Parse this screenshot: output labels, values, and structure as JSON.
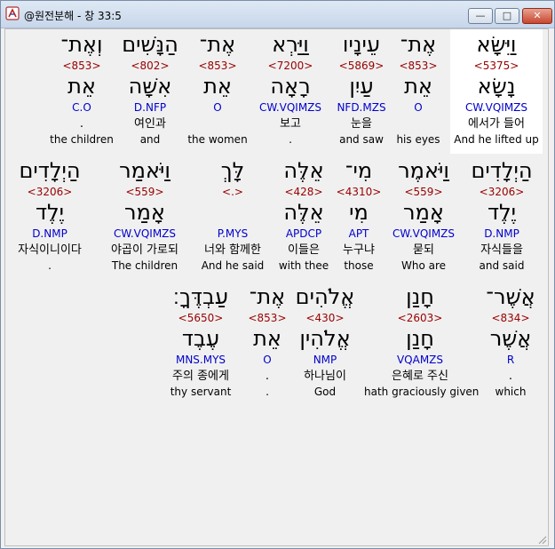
{
  "window": {
    "title": "@원전분해 - 창 33:5",
    "minimize_glyph": "—",
    "maximize_glyph": "□",
    "close_glyph": "✕"
  },
  "rows": [
    [
      {
        "heb1": "וַיִּשָּׂא",
        "num": "<5375>",
        "heb2": "נָשָׂא",
        "parse": "CW.VQIMZS",
        "kor": "에서가 들어",
        "eng": "And he lifted up"
      },
      {
        "heb1": "אֶת־",
        "num": "<853>",
        "heb2": "אֵת",
        "parse": "O",
        "kor": "",
        "eng": "his eyes"
      },
      {
        "heb1": "עֵינָיו",
        "num": "<5869>",
        "heb2": "עַיִן",
        "parse": "NFD.MZS",
        "kor": "눈을",
        "eng": "and saw"
      },
      {
        "heb1": "וַיַּרְא",
        "num": "<7200>",
        "heb2": "רָאָה",
        "parse": "CW.VQIMZS",
        "kor": "보고",
        "eng": "."
      },
      {
        "heb1": "אֶת־",
        "num": "<853>",
        "heb2": "אֵת",
        "parse": "O",
        "kor": "",
        "eng": "the women"
      },
      {
        "heb1": "הַנָּשִׁים",
        "num": "<802>",
        "heb2": "אִשָּׁה",
        "parse": "D.NFP",
        "kor": "여인과",
        "eng": "and"
      },
      {
        "heb1": "וְאֶת־",
        "num": "<853>",
        "heb2": "אֵת",
        "parse": "C.O",
        "kor": ".",
        "eng": "the children"
      }
    ],
    [
      {
        "heb1": "הַיְלָדִים",
        "num": "<3206>",
        "heb2": "יֶלֶד",
        "parse": "D.NMP",
        "kor": "자식들을",
        "eng": "and said"
      },
      {
        "heb1": "וַיֹּאמֶר",
        "num": "<559>",
        "heb2": "אָמַר",
        "parse": "CW.VQIMZS",
        "kor": "묻되",
        "eng": "Who are"
      },
      {
        "heb1": "מִי־",
        "num": "<4310>",
        "heb2": "מִי",
        "parse": "APT",
        "kor": "누구냐",
        "eng": "those"
      },
      {
        "heb1": "אֵלֶּה",
        "num": "<428>",
        "heb2": "אֵלֶּה",
        "parse": "APDCP",
        "kor": "이들은",
        "eng": "with thee"
      },
      {
        "heb1": "לָּךְ",
        "num": "<.>",
        "heb2": "",
        "parse": "P.MYS",
        "kor": "너와 함께한",
        "eng": "And he said"
      },
      {
        "heb1": "וַיֹּאמַר",
        "num": "<559>",
        "heb2": "אָמַר",
        "parse": "CW.VQIMZS",
        "kor": "야곱이 가로되",
        "eng": "The children"
      },
      {
        "heb1": "הַיְלָדִים",
        "num": "<3206>",
        "heb2": "יֶלֶד",
        "parse": "D.NMP",
        "kor": "자식이니이다",
        "eng": "."
      }
    ],
    [
      {
        "heb1": "אֲשֶׁר־",
        "num": "<834>",
        "heb2": "אֲשֶׁר",
        "parse": "R",
        "kor": ".",
        "eng": "which"
      },
      {
        "heb1": "חָנַן",
        "num": "<2603>",
        "heb2": "חָנַן",
        "parse": "VQAMZS",
        "kor": "은혜로 주신",
        "eng": "hath graciously given"
      },
      {
        "heb1": "אֱלֹהִים",
        "num": "<430>",
        "heb2": "אֱלֹהִין",
        "parse": "NMP",
        "kor": "하나님이",
        "eng": "God"
      },
      {
        "heb1": "אֶת־",
        "num": "<853>",
        "heb2": "אֵת",
        "parse": "O",
        "kor": ".",
        "eng": "."
      },
      {
        "heb1": "עַבְדֶּךָ׃",
        "num": "<5650>",
        "heb2": "עֶבֶד",
        "parse": "MNS.MYS",
        "kor": "주의 종에게",
        "eng": "thy servant"
      }
    ]
  ]
}
